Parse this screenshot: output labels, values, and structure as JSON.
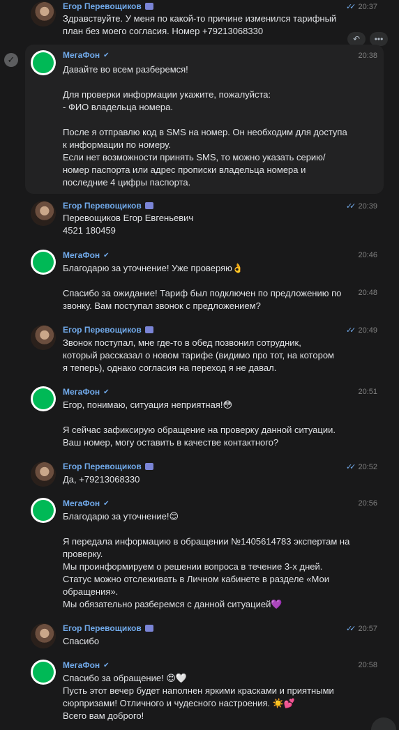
{
  "messages": [
    {
      "author": "Егор Перевощиков",
      "time": "20:37",
      "lines": [
        "Здравствуйте. У меня по какой-то причине изменился тарифный",
        "план без моего согласия. Номер +79213068330"
      ]
    },
    {
      "author": "МегаФон",
      "time": "20:38",
      "lines": [
        "Давайте во всем разберемся!",
        "",
        "Для проверки информации укажите, пожалуйста:",
        "- ФИО владельца номера.",
        "",
        "После я отправлю код в SMS на номер. Он необходим для доступа",
        "к информации по номеру.",
        "Если нет возможности принять SMS, то можно указать серию/",
        "номер паспорта или адрес прописки владельца номера и",
        "последние 4 цифры паспорта."
      ]
    },
    {
      "author": "Егор Перевощиков",
      "time": "20:39",
      "lines": [
        "Перевощиков Егор Евгеньевич",
        "4521 180459"
      ]
    },
    {
      "author": "МегаФон",
      "time": "20:46",
      "lines": [
        "Благодарю за уточнение! Уже проверяю👌"
      ]
    },
    {
      "time2": "20:48",
      "lines": [
        "Спасибо за ожидание! Тариф был подключен по предложению по",
        "звонку. Вам поступал звонок с предложением?"
      ]
    },
    {
      "author": "Егор Перевощиков",
      "time": "20:49",
      "lines": [
        "Звонок поступал, мне где-то в обед позвонил сотрудник,",
        "который рассказал о новом тарифе (видимо про тот, на котором",
        "я теперь), однако согласия на переход я не давал."
      ]
    },
    {
      "author": "МегаФон",
      "time": "20:51",
      "lines": [
        "Егор, понимаю, ситуация неприятная!😳",
        "",
        "Я сейчас зафиксирую обращение на проверку данной ситуации.",
        "Ваш номер, могу оставить в качестве контактного?"
      ]
    },
    {
      "author": "Егор Перевощиков",
      "time": "20:52",
      "lines": [
        "Да,  +79213068330"
      ]
    },
    {
      "author": "МегаФон",
      "time": "20:56",
      "lines": [
        "Благодарю за уточнение!😊",
        "",
        "Я передала информацию в обращении №1405614783 экспертам на",
        "проверку.",
        "Мы проинформируем о решении вопроса в течение 3-х дней.",
        "Статус можно отслеживать в Личном кабинете в разделе «Мои",
        "обращения».",
        "Мы обязательно разберемся с данной ситуацией💜"
      ]
    },
    {
      "author": "Егор Перевощиков",
      "time": "20:57",
      "lines": [
        "Спасибо"
      ]
    },
    {
      "author": "МегаФон",
      "time": "20:58",
      "lines": [
        "Спасибо за обращение! 😍🤍",
        "Пусть этот вечер будет наполнен яркими красками и приятными",
        "сюрпризами! Отличного и чудесного настроения. ☀️💕",
        "Всего вам доброго!"
      ]
    }
  ]
}
